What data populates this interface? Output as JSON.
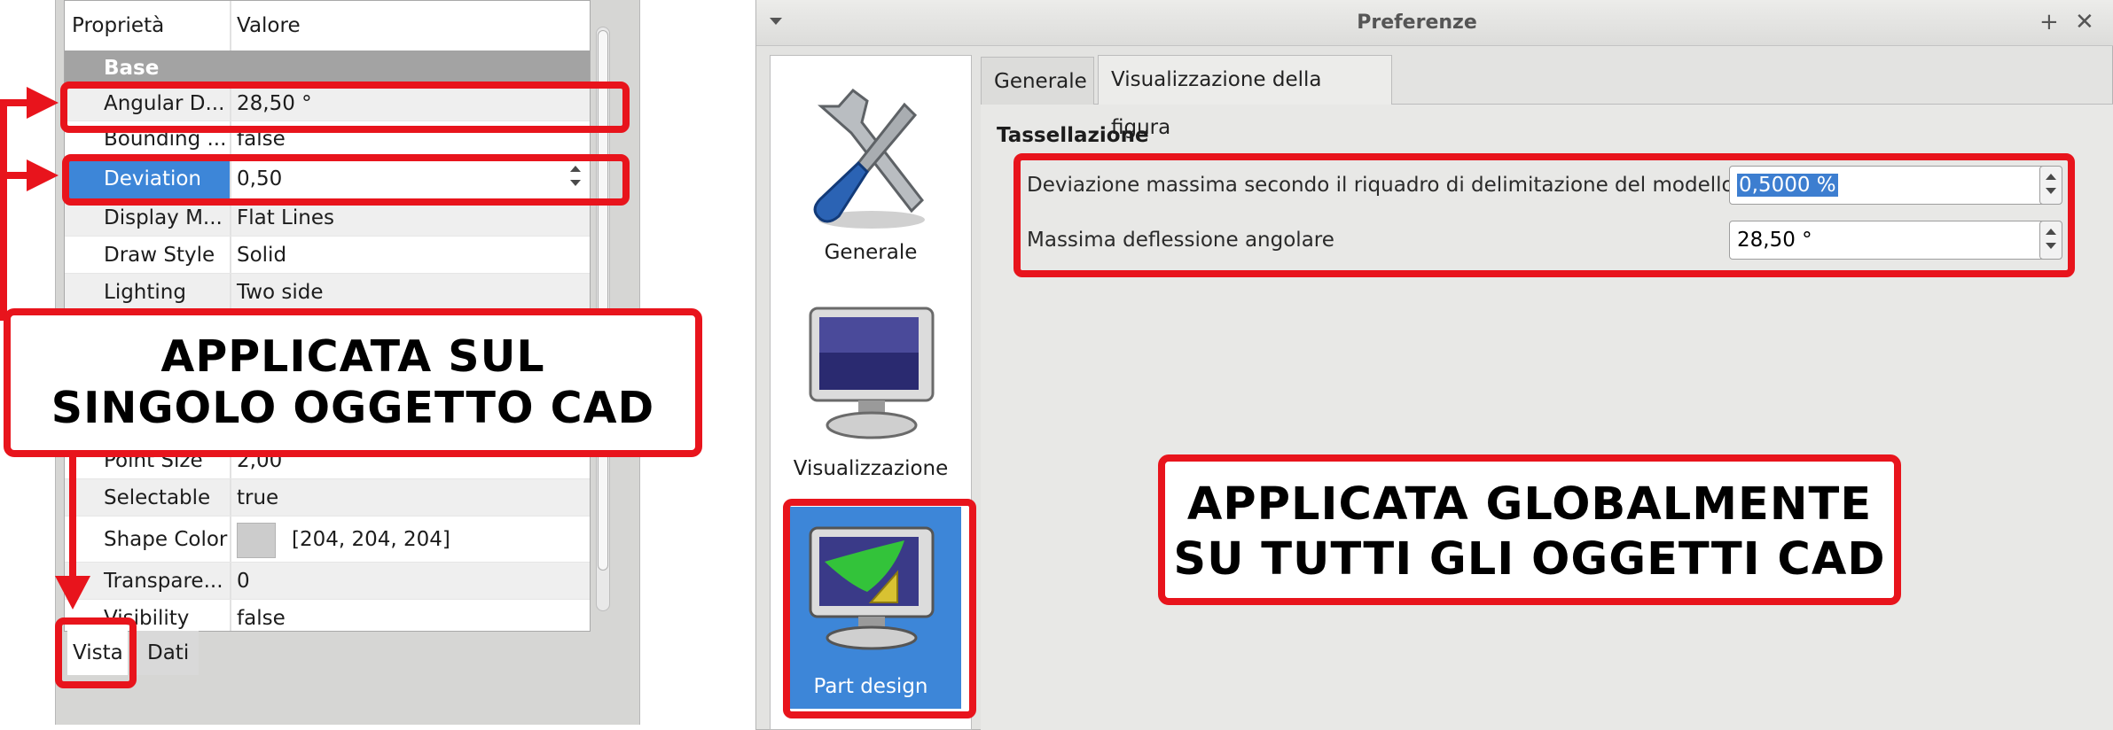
{
  "property_editor": {
    "columns": [
      "Proprietà",
      "Valore"
    ],
    "group": "Base",
    "rows": [
      {
        "name": "Angular D...",
        "value": "28,50 °"
      },
      {
        "name": "Bounding ...",
        "value": "false"
      },
      {
        "name": "Deviation",
        "value": "0,50"
      },
      {
        "name": "Display M...",
        "value": "Flat Lines"
      },
      {
        "name": "Draw Style",
        "value": "Solid"
      },
      {
        "name": "Lighting",
        "value": "Two side"
      },
      {
        "name": "Point Size",
        "value": "2,00"
      },
      {
        "name": "Selectable",
        "value": "true"
      },
      {
        "name": "Shape Color",
        "value": "[204, 204, 204]"
      },
      {
        "name": "Transpare...",
        "value": "0"
      },
      {
        "name": "Visibility",
        "value": "false"
      }
    ],
    "tabs": [
      "Vista",
      "Dati"
    ]
  },
  "annotations": {
    "left_callout_line1": "APPLICATA SUL",
    "left_callout_line2": "SINGOLO OGGETTO CAD",
    "right_callout_line1": "APPLICATA GLOBALMENTE",
    "right_callout_line2": "SU TUTTI GLI OGGETTI CAD",
    "accent_color": "#e8141c"
  },
  "dialog": {
    "title": "Preferenze",
    "categories": [
      "Generale",
      "Visualizzazione",
      "Part design"
    ],
    "tabs": [
      "Generale",
      "Visualizzazione della figura"
    ],
    "section": "Tassellazione",
    "deviation_label": "Deviazione massima secondo il riquadro di delimitazione del modello",
    "deviation_value": "0,5000 %",
    "angular_label": "Massima deflessione angolare",
    "angular_value": "28,50 °",
    "selection_color": "#3d86d8"
  }
}
